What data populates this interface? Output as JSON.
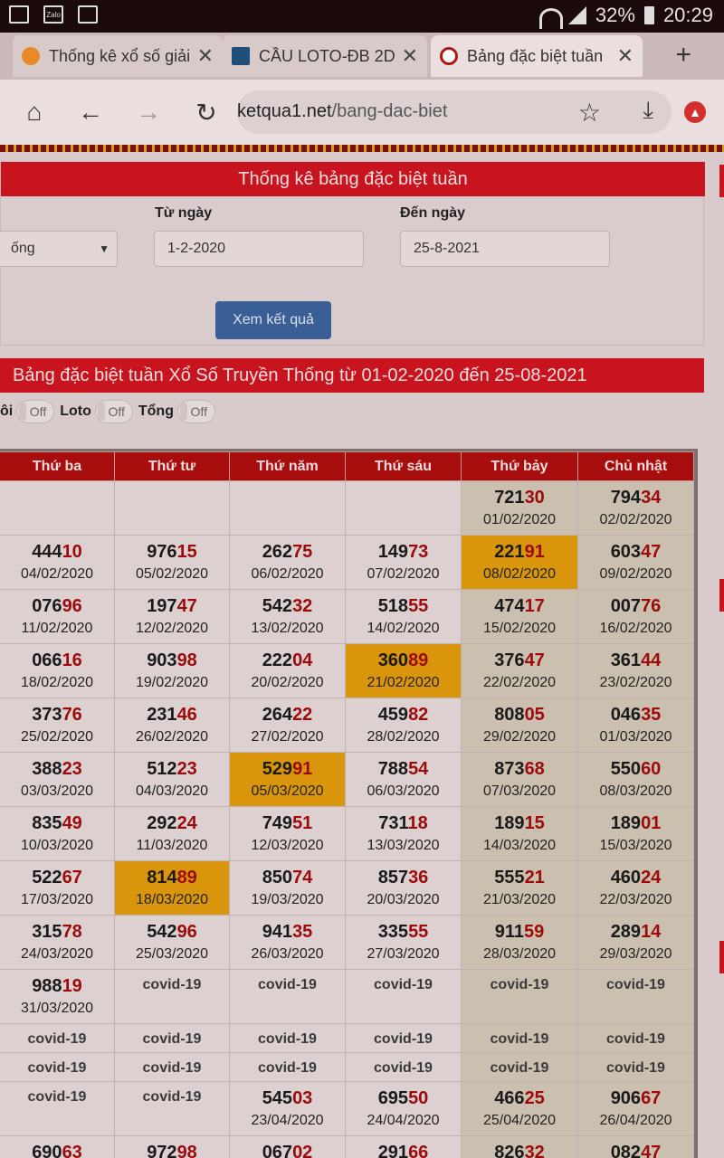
{
  "statusbar": {
    "battery": "32%",
    "time": "20:29",
    "left_icons": [
      "cast-icon",
      "zalo-icon",
      "notification-icon"
    ]
  },
  "browser": {
    "tabs": [
      {
        "title": "Thống kê xổ số giải",
        "active": false,
        "favicon_color": "#e88a2a"
      },
      {
        "title": "CẦU LOTO-ĐB 2D",
        "active": false,
        "favicon_color": "#1e4f7a"
      },
      {
        "title": "Bảng đặc biệt tuần",
        "active": true,
        "favicon_color": "#b01818"
      }
    ],
    "new_tab": "+",
    "url_host": "ketqua1.net",
    "url_path": "/bang-dac-biet"
  },
  "filter": {
    "title": "Thống kê bảng đặc biệt tuần",
    "from_label": "Từ ngày",
    "to_label": "Đến ngày",
    "select_value": "ống",
    "from_value": "1-2-2020",
    "to_value": "25-8-2021",
    "submit": "Xem kết quả"
  },
  "result": {
    "title": "Bảng đặc biệt tuần Xổ Số Truyền Thống từ 01-02-2020 đến 25-08-2021",
    "toggles": [
      {
        "label": "ôi",
        "state": "Off"
      },
      {
        "label": "Loto",
        "state": "Off"
      },
      {
        "label": "Tổng",
        "state": "Off"
      }
    ]
  },
  "table": {
    "headers": [
      "Thứ ba",
      "Thứ tư",
      "Thứ năm",
      "Thứ sáu",
      "Thứ bảy",
      "Chủ nhật"
    ],
    "rows": [
      [
        null,
        null,
        null,
        null,
        {
          "h": "721",
          "t": "30",
          "d": "01/02/2020"
        },
        {
          "h": "794",
          "t": "34",
          "d": "02/02/2020"
        }
      ],
      [
        {
          "h": "444",
          "t": "10",
          "d": "04/02/2020"
        },
        {
          "h": "976",
          "t": "15",
          "d": "05/02/2020"
        },
        {
          "h": "262",
          "t": "75",
          "d": "06/02/2020"
        },
        {
          "h": "149",
          "t": "73",
          "d": "07/02/2020"
        },
        {
          "h": "221",
          "t": "91",
          "d": "08/02/2020",
          "hl": true
        },
        {
          "h": "603",
          "t": "47",
          "d": "09/02/2020"
        }
      ],
      [
        {
          "h": "076",
          "t": "96",
          "d": "11/02/2020"
        },
        {
          "h": "197",
          "t": "47",
          "d": "12/02/2020"
        },
        {
          "h": "542",
          "t": "32",
          "d": "13/02/2020"
        },
        {
          "h": "518",
          "t": "55",
          "d": "14/02/2020"
        },
        {
          "h": "474",
          "t": "17",
          "d": "15/02/2020"
        },
        {
          "h": "007",
          "t": "76",
          "d": "16/02/2020"
        }
      ],
      [
        {
          "h": "066",
          "t": "16",
          "d": "18/02/2020"
        },
        {
          "h": "903",
          "t": "98",
          "d": "19/02/2020"
        },
        {
          "h": "222",
          "t": "04",
          "d": "20/02/2020"
        },
        {
          "h": "360",
          "t": "89",
          "d": "21/02/2020",
          "hl": true
        },
        {
          "h": "376",
          "t": "47",
          "d": "22/02/2020"
        },
        {
          "h": "361",
          "t": "44",
          "d": "23/02/2020"
        }
      ],
      [
        {
          "h": "373",
          "t": "76",
          "d": "25/02/2020"
        },
        {
          "h": "231",
          "t": "46",
          "d": "26/02/2020"
        },
        {
          "h": "264",
          "t": "22",
          "d": "27/02/2020"
        },
        {
          "h": "459",
          "t": "82",
          "d": "28/02/2020"
        },
        {
          "h": "808",
          "t": "05",
          "d": "29/02/2020"
        },
        {
          "h": "046",
          "t": "35",
          "d": "01/03/2020"
        }
      ],
      [
        {
          "h": "388",
          "t": "23",
          "d": "03/03/2020"
        },
        {
          "h": "512",
          "t": "23",
          "d": "04/03/2020"
        },
        {
          "h": "529",
          "t": "91",
          "d": "05/03/2020",
          "hl": true
        },
        {
          "h": "788",
          "t": "54",
          "d": "06/03/2020"
        },
        {
          "h": "873",
          "t": "68",
          "d": "07/03/2020"
        },
        {
          "h": "550",
          "t": "60",
          "d": "08/03/2020"
        }
      ],
      [
        {
          "h": "835",
          "t": "49",
          "d": "10/03/2020"
        },
        {
          "h": "292",
          "t": "24",
          "d": "11/03/2020"
        },
        {
          "h": "749",
          "t": "51",
          "d": "12/03/2020"
        },
        {
          "h": "731",
          "t": "18",
          "d": "13/03/2020"
        },
        {
          "h": "189",
          "t": "15",
          "d": "14/03/2020"
        },
        {
          "h": "189",
          "t": "01",
          "d": "15/03/2020"
        }
      ],
      [
        {
          "h": "522",
          "t": "67",
          "d": "17/03/2020"
        },
        {
          "h": "814",
          "t": "89",
          "d": "18/03/2020",
          "hl": true
        },
        {
          "h": "850",
          "t": "74",
          "d": "19/03/2020"
        },
        {
          "h": "857",
          "t": "36",
          "d": "20/03/2020"
        },
        {
          "h": "555",
          "t": "21",
          "d": "21/03/2020"
        },
        {
          "h": "460",
          "t": "24",
          "d": "22/03/2020"
        }
      ],
      [
        {
          "h": "315",
          "t": "78",
          "d": "24/03/2020"
        },
        {
          "h": "542",
          "t": "96",
          "d": "25/03/2020"
        },
        {
          "h": "941",
          "t": "35",
          "d": "26/03/2020"
        },
        {
          "h": "335",
          "t": "55",
          "d": "27/03/2020"
        },
        {
          "h": "911",
          "t": "59",
          "d": "28/03/2020"
        },
        {
          "h": "289",
          "t": "14",
          "d": "29/03/2020"
        }
      ],
      [
        {
          "h": "988",
          "t": "19",
          "d": "31/03/2020"
        },
        {
          "c": "covid-19"
        },
        {
          "c": "covid-19"
        },
        {
          "c": "covid-19"
        },
        {
          "c": "covid-19"
        },
        {
          "c": "covid-19"
        }
      ],
      [
        {
          "c": "covid-19",
          "short": true
        },
        {
          "c": "covid-19",
          "short": true
        },
        {
          "c": "covid-19",
          "short": true
        },
        {
          "c": "covid-19",
          "short": true
        },
        {
          "c": "covid-19",
          "short": true
        },
        {
          "c": "covid-19",
          "short": true
        }
      ],
      [
        {
          "c": "covid-19",
          "short": true
        },
        {
          "c": "covid-19",
          "short": true
        },
        {
          "c": "covid-19",
          "short": true
        },
        {
          "c": "covid-19",
          "short": true
        },
        {
          "c": "covid-19",
          "short": true
        },
        {
          "c": "covid-19",
          "short": true
        }
      ],
      [
        {
          "c": "covid-19"
        },
        {
          "c": "covid-19"
        },
        {
          "h": "545",
          "t": "03",
          "d": "23/04/2020"
        },
        {
          "h": "695",
          "t": "50",
          "d": "24/04/2020"
        },
        {
          "h": "466",
          "t": "25",
          "d": "25/04/2020"
        },
        {
          "h": "906",
          "t": "67",
          "d": "26/04/2020"
        }
      ],
      [
        {
          "h": "690",
          "t": "63",
          "d": ""
        },
        {
          "h": "972",
          "t": "98",
          "d": ""
        },
        {
          "h": "067",
          "t": "02",
          "d": ""
        },
        {
          "h": "291",
          "t": "66",
          "d": ""
        },
        {
          "h": "826",
          "t": "32",
          "d": ""
        },
        {
          "h": "082",
          "t": "47",
          "d": ""
        }
      ]
    ]
  },
  "colors": {
    "accent_red": "#c8141e",
    "header_red": "#a80d0d",
    "highlight": "#d9960c",
    "button_blue": "#3a5f96"
  }
}
